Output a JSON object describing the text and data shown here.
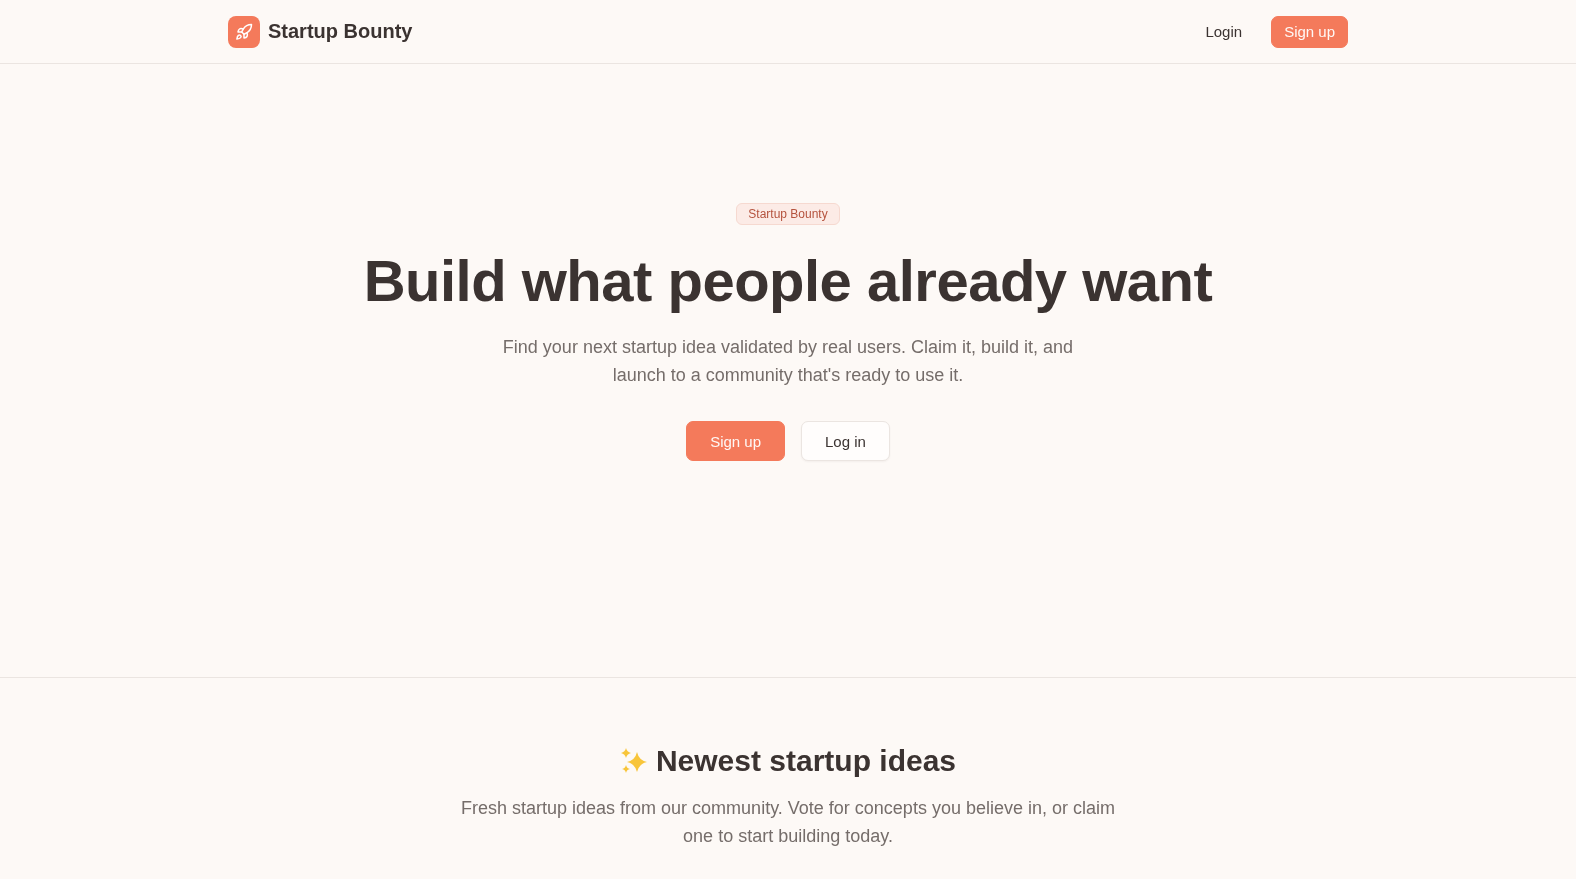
{
  "header": {
    "brand": "Startup Bounty",
    "nav": [
      {
        "label": "Login",
        "kind": "link"
      },
      {
        "label": "Sign up",
        "kind": "primary"
      }
    ]
  },
  "hero": {
    "badge": "Startup Bounty",
    "title": "Build what people already want",
    "subtitle": "Find your next startup idea validated by real users. Claim it, build it, and launch to a community that's ready to use it.",
    "actions": [
      {
        "label": "Sign up",
        "kind": "primary"
      },
      {
        "label": "Log in",
        "kind": "secondary"
      }
    ]
  },
  "ideas_section": {
    "title": "Newest startup ideas",
    "subtitle": "Fresh startup ideas from our community. Vote for concepts you believe in, or claim one to start building today."
  }
}
